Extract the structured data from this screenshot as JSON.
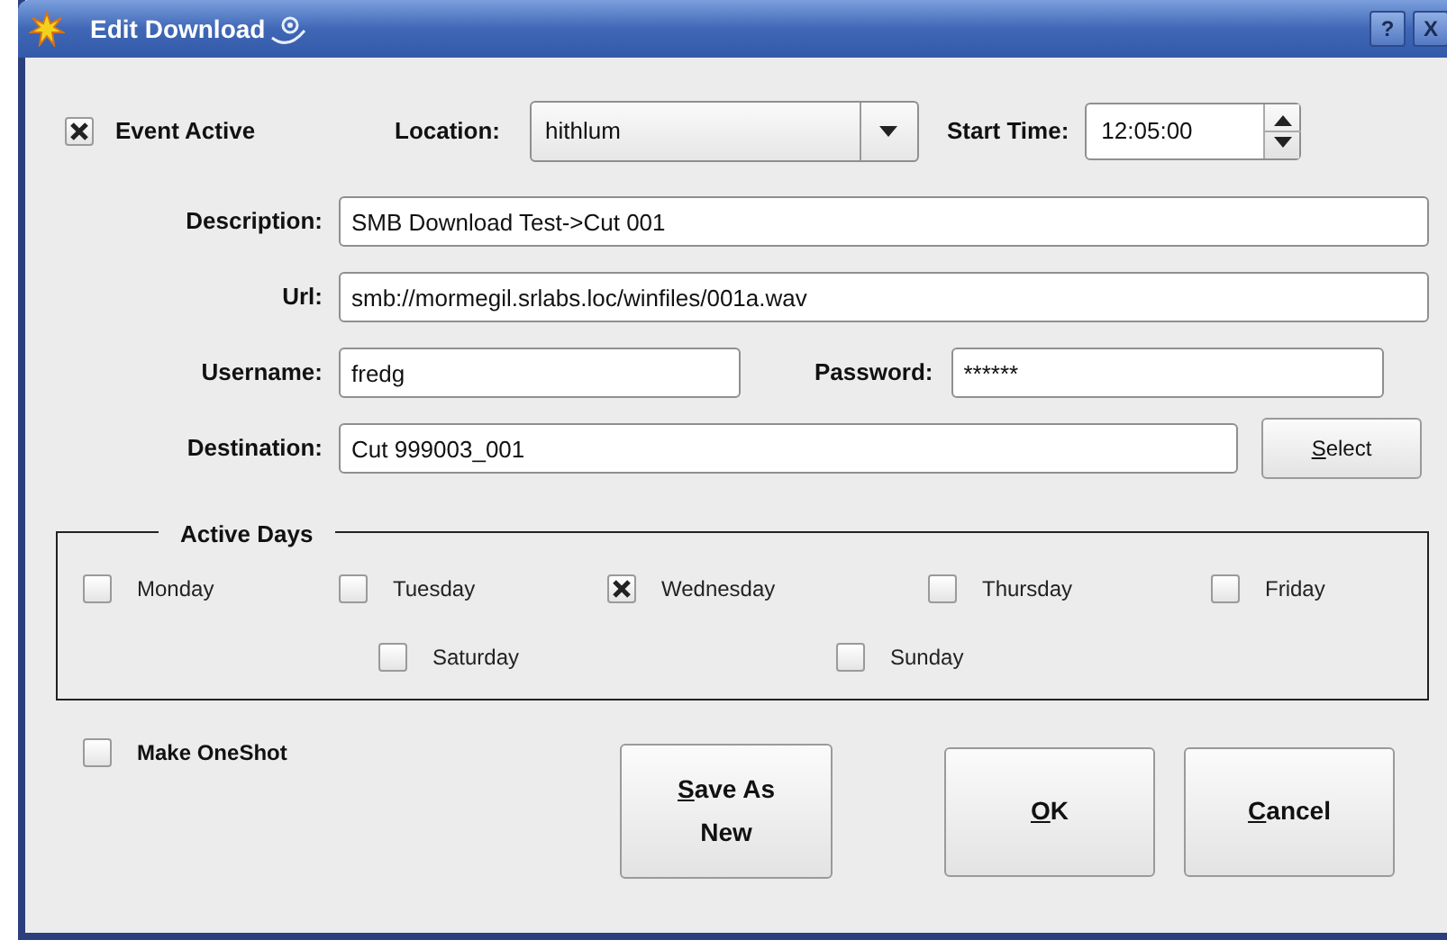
{
  "window": {
    "title": "Edit Download",
    "help_button": "?",
    "close_button": "X"
  },
  "event_active": {
    "label": "Event Active",
    "checked": true
  },
  "location": {
    "label": "Location:",
    "value": "hithlum"
  },
  "start_time": {
    "label": "Start Time:",
    "value": "12:05:00"
  },
  "description": {
    "label": "Description:",
    "value": "SMB Download Test->Cut 001"
  },
  "url": {
    "label": "Url:",
    "value": "smb://mormegil.srlabs.loc/winfiles/001a.wav"
  },
  "username": {
    "label": "Username:",
    "value": "fredg"
  },
  "password": {
    "label": "Password:",
    "value": "******"
  },
  "destination": {
    "label": "Destination:",
    "value": "Cut 999003_001",
    "button": {
      "accel": "S",
      "rest": "elect"
    }
  },
  "active_days": {
    "title": "Active Days",
    "days": [
      {
        "label": "Monday",
        "checked": false
      },
      {
        "label": "Tuesday",
        "checked": false
      },
      {
        "label": "Wednesday",
        "checked": true
      },
      {
        "label": "Thursday",
        "checked": false
      },
      {
        "label": "Friday",
        "checked": false
      },
      {
        "label": "Saturday",
        "checked": false
      },
      {
        "label": "Sunday",
        "checked": false
      }
    ]
  },
  "make_oneshot": {
    "label": "Make OneShot",
    "checked": false
  },
  "buttons": [
    {
      "kind": "save_new",
      "accel": "S",
      "rest": "ave As New"
    },
    {
      "kind": "ok",
      "accel": "O",
      "rest": "K"
    },
    {
      "kind": "cancel",
      "accel": "C",
      "rest": "ancel"
    }
  ]
}
